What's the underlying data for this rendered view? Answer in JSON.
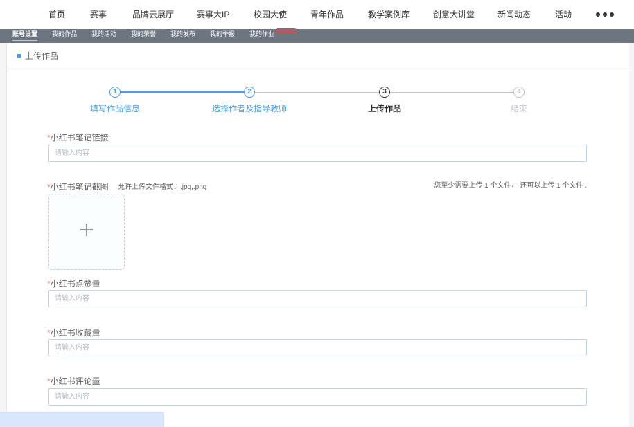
{
  "nav": {
    "items": [
      "首页",
      "赛事",
      "品牌云展厅",
      "赛事大IP",
      "校园大使",
      "青年作品",
      "教学案例库",
      "创意大讲堂",
      "新闻动态",
      "活动"
    ],
    "more_icon": "more-horizontal-icon"
  },
  "subnav": {
    "items": [
      "账号设置",
      "我的作品",
      "我的活动",
      "我的荣誉",
      "我的发布",
      "我的举报",
      "我的作业"
    ],
    "active_index": 0
  },
  "page": {
    "title": "上传作品",
    "title_icon": "square-marker-icon"
  },
  "current_step": 3,
  "steps": [
    {
      "number": "1",
      "label": "填写作品信息"
    },
    {
      "number": "2",
      "label": "选择作者及指导教师"
    },
    {
      "number": "3",
      "label": "上传作品"
    },
    {
      "number": "4",
      "label": "结束"
    }
  ],
  "form": {
    "note_link": {
      "required_mark": "*",
      "label": "小红书笔记链接",
      "value": "",
      "placeholder": "请输入内容"
    },
    "note_screenshot": {
      "required_mark": "*",
      "label": "小红书笔记截图",
      "format_hint": "允许上传文件格式：.jpg,.png",
      "upload_count_note": "您至少需要上传 1 个文件， 还可以上传 1 个文件 .",
      "upload_icon": "plus-icon"
    },
    "likes": {
      "required_mark": "*",
      "label": "小红书点赞量",
      "value": "",
      "placeholder": "请输入内容"
    },
    "favorites": {
      "required_mark": "*",
      "label": "小红书收藏量",
      "value": "",
      "placeholder": "请输入内容"
    },
    "comments": {
      "required_mark": "*",
      "label": "小红书评论量",
      "value": "",
      "placeholder": "请输入内容"
    }
  },
  "colors": {
    "accent": "#409eff",
    "required": "#f56c6c",
    "subnav_bg": "#6d7581",
    "step_process": "#303133",
    "step_wait": "#c0c4cc"
  }
}
